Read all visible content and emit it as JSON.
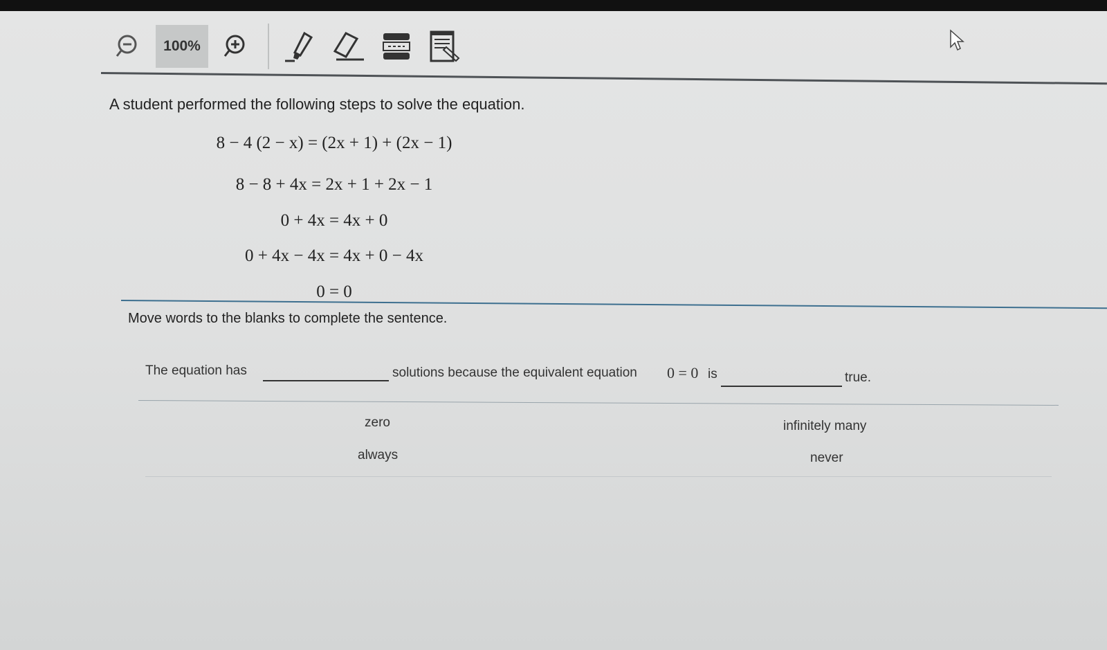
{
  "toolbar": {
    "zoom_level": "100%",
    "buttons": [
      {
        "name": "zoom-out-button",
        "icon": "zoom-out-icon"
      },
      {
        "name": "zoom-in-button",
        "icon": "zoom-in-icon"
      },
      {
        "name": "highlighter-button",
        "icon": "highlighter-icon"
      },
      {
        "name": "eraser-button",
        "icon": "eraser-icon"
      },
      {
        "name": "line-reader-button",
        "icon": "line-reader-icon"
      },
      {
        "name": "notepad-button",
        "icon": "notepad-icon"
      }
    ]
  },
  "question": {
    "prompt": "A student performed the following steps to solve the equation.",
    "steps": [
      "8 − 4 (2 − x) = (2x + 1) + (2x − 1)",
      "8 − 8 + 4x = 2x + 1 + 2x − 1",
      "0 + 4x = 4x + 0",
      "0 + 4x − 4x = 4x + 0 − 4x",
      "0 = 0"
    ],
    "instruction": "Move words to the blanks to complete the sentence.",
    "sentence": {
      "part1": "The equation has",
      "part2": "solutions because the equivalent equation",
      "equation": "0 = 0",
      "part3": "is",
      "part4": "true."
    },
    "word_bank": [
      "zero",
      "infinitely many",
      "always",
      "never"
    ]
  },
  "colors": {
    "accent_rule": "#3d6f8f",
    "toolbar_rule": "#4e5256",
    "background": "#dfe0e0"
  }
}
